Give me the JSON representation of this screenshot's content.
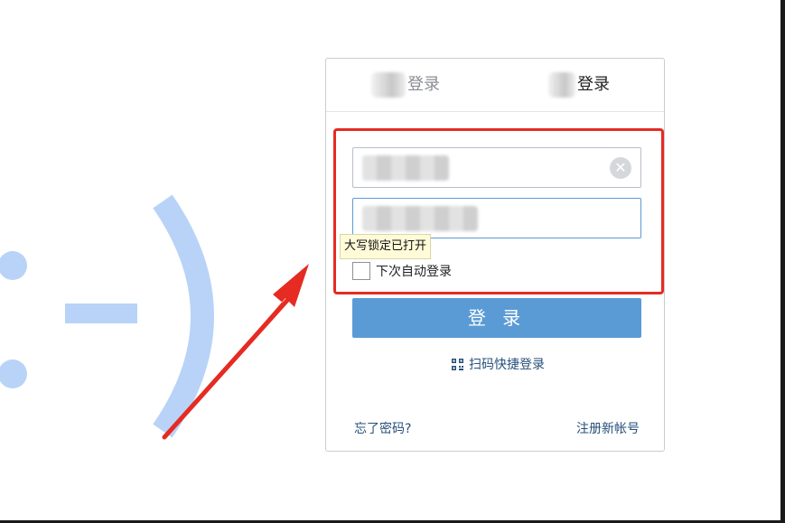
{
  "tabs": [
    {
      "label": "登录"
    },
    {
      "label": "登录"
    }
  ],
  "login_form": {
    "username_value": "",
    "password_value": "",
    "clear_icon": "close-icon",
    "caps_lock_tooltip": "大写锁定已打开",
    "remember_label": "下次自动登录",
    "remember_checked": false,
    "login_button_label": "登 录",
    "qr_login_label": "扫码快捷登录",
    "qr_icon": "qr-code-icon"
  },
  "footer": {
    "forgot_password_label": "忘了密码?",
    "register_label": "注册新帐号"
  },
  "colors": {
    "accent": "#5b9bd5",
    "highlight_red": "#e52b22",
    "link": "#27507a",
    "decor_blue": "#b8d3f7"
  }
}
